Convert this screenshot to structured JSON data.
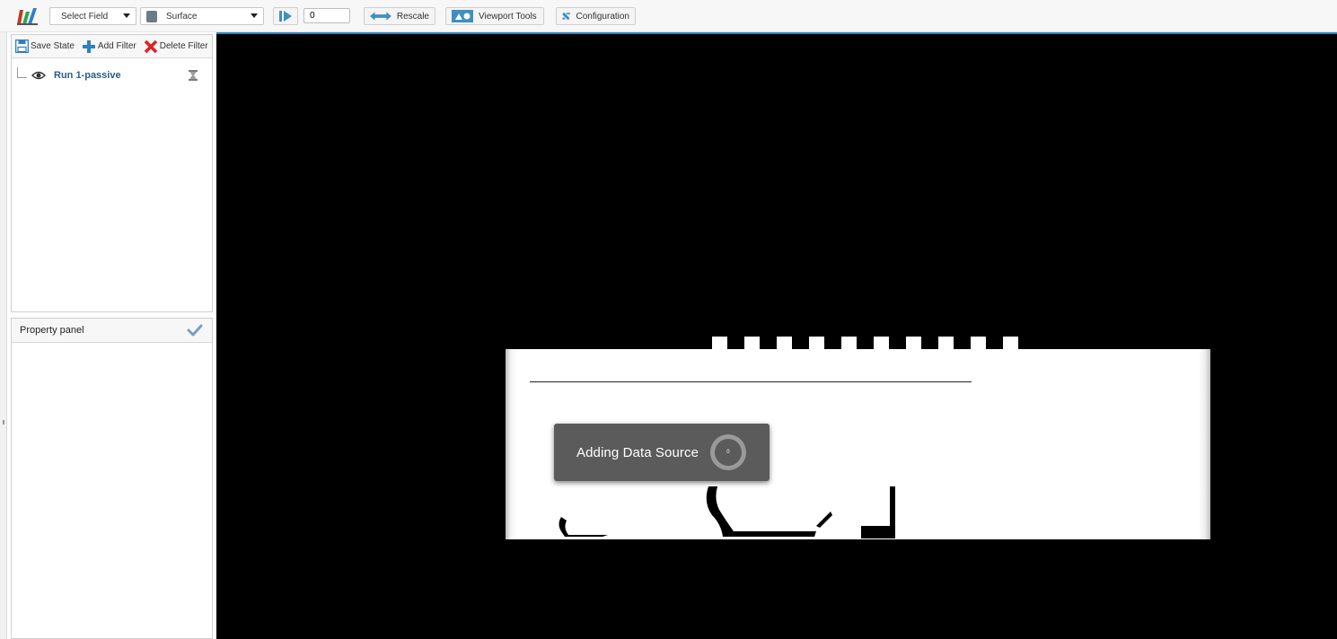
{
  "toolbar": {
    "field_select": "Select Field",
    "representation_select": "Surface",
    "time_value": "0",
    "rescale_label": "Rescale",
    "viewport_tools_label": "Viewport Tools",
    "configuration_label": "Configuration"
  },
  "pipeline": {
    "save_state_label": "Save State",
    "add_filter_label": "Add Filter",
    "delete_filter_label": "Delete Filter",
    "items": [
      {
        "label": "Run 1-passive",
        "visible": true
      }
    ]
  },
  "property_panel": {
    "title": "Property panel"
  },
  "viewport": {
    "toast_message": "Adding Data Source",
    "progress_text": "0"
  },
  "colors": {
    "accent": "#3f8fc0",
    "link": "#2a5d86",
    "toast_bg": "#5b5b5b",
    "delete_red": "#e02020",
    "add_blue": "#2f7fc1",
    "check": "#7a9fc0"
  }
}
